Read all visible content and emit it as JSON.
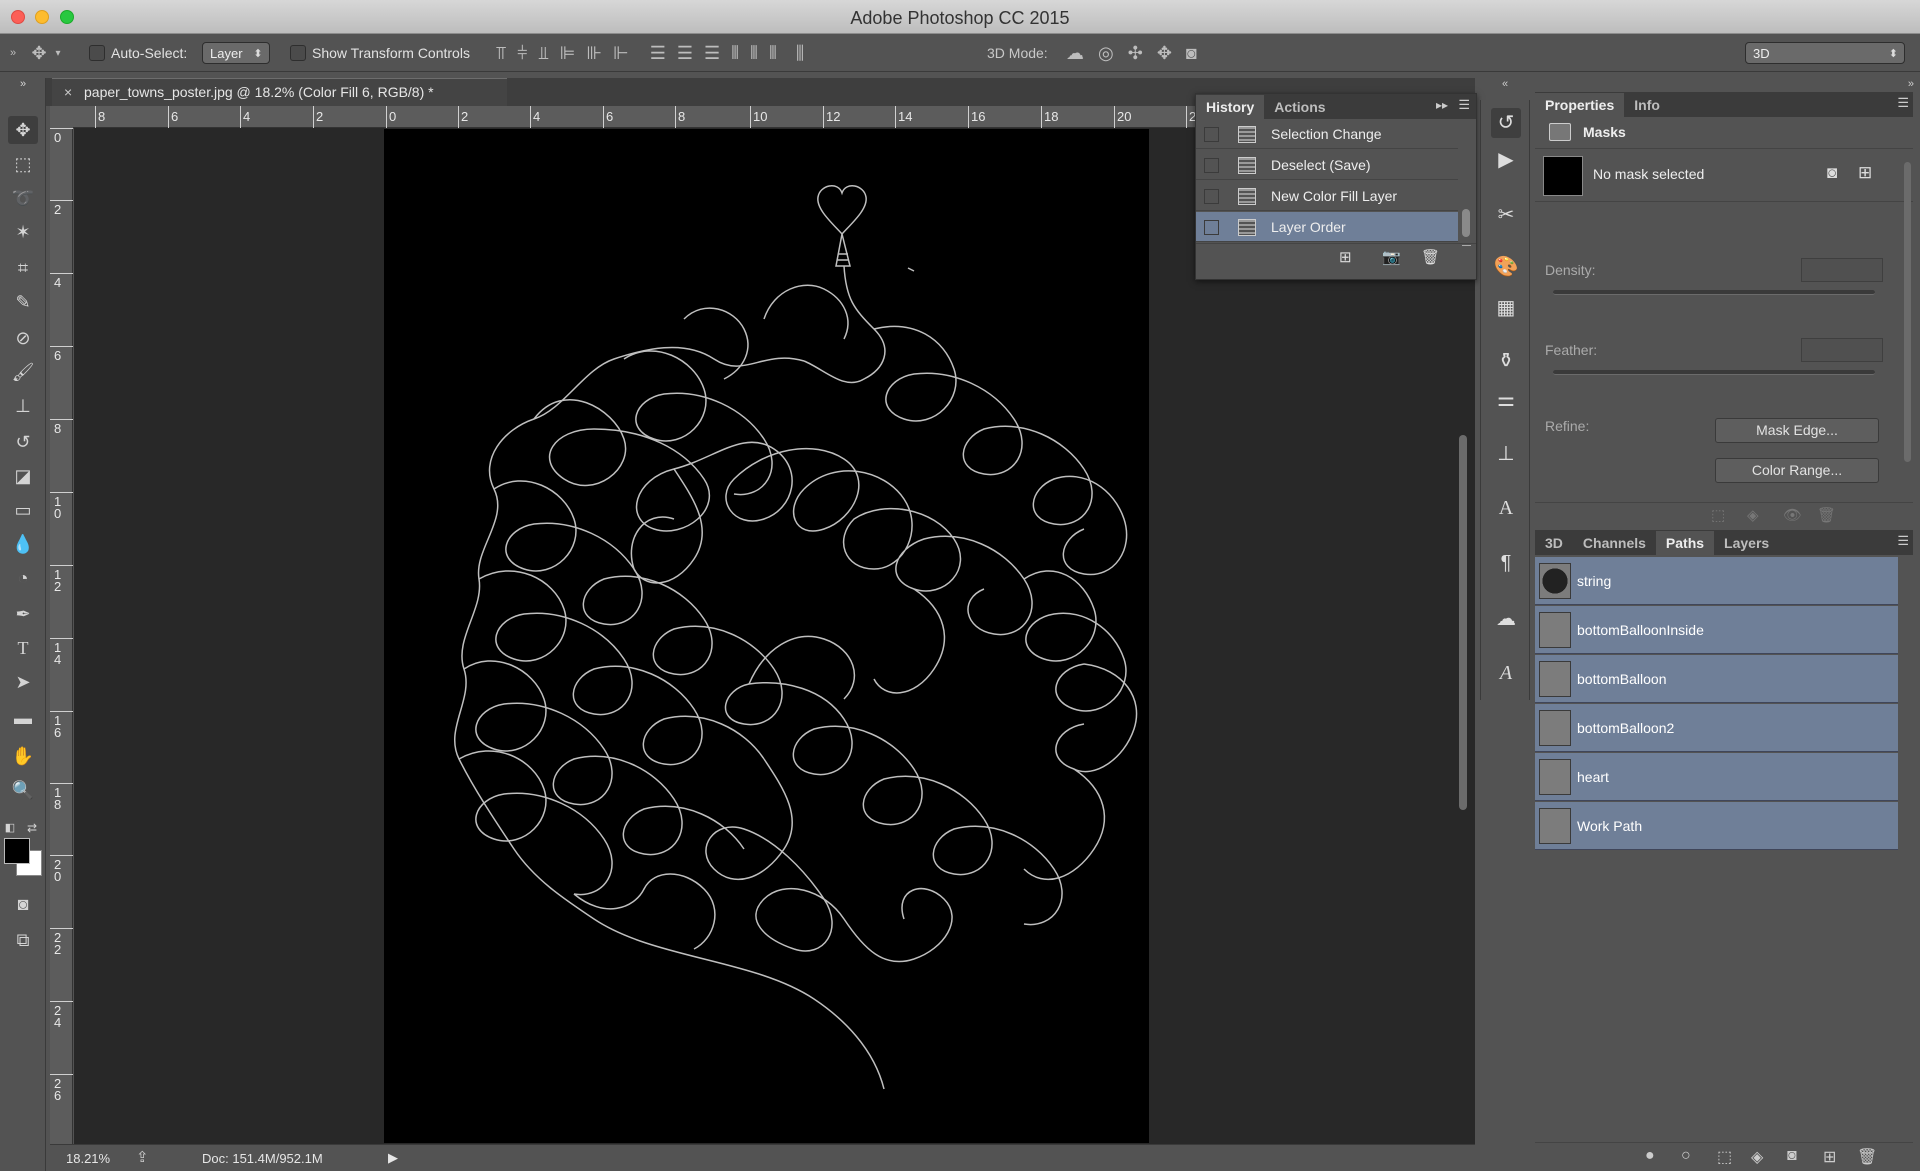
{
  "app": {
    "title": "Adobe Photoshop CC 2015"
  },
  "options": {
    "auto_select_label": "Auto-Select:",
    "auto_select_value": "Layer",
    "transform_label": "Show Transform Controls",
    "mode_label": "3D Mode:",
    "workspace_value": "3D"
  },
  "document": {
    "tab_title": "paper_towns_poster.jpg @ 18.2% (Color Fill 6, RGB/8) *"
  },
  "ruler": {
    "h_labels": [
      "8",
      "6",
      "4",
      "2",
      "0",
      "2",
      "4",
      "6",
      "8",
      "10",
      "12",
      "14",
      "16",
      "18",
      "20",
      "2"
    ],
    "v_labels": [
      "0",
      "2",
      "4",
      "6",
      "8",
      "1\n0",
      "1\n2",
      "1\n4",
      "1\n6",
      "1\n8",
      "2\n0",
      "2\n2",
      "2\n4",
      "2\n6"
    ]
  },
  "status": {
    "zoom": "18.21%",
    "doc": "Doc: 151.4M/952.1M"
  },
  "history": {
    "tabs": [
      "History",
      "Actions"
    ],
    "items": [
      "Selection Change",
      "Deselect (Save)",
      "New Color Fill Layer",
      "Layer Order"
    ],
    "selected_index": 3
  },
  "properties": {
    "tabs": [
      "Properties",
      "Info"
    ],
    "section": "Masks",
    "mask_status": "No mask selected",
    "density_label": "Density:",
    "feather_label": "Feather:",
    "refine_label": "Refine:",
    "mask_edge_button": "Mask Edge...",
    "color_range_button": "Color Range..."
  },
  "paths_panel": {
    "tabs": [
      "3D",
      "Channels",
      "Paths",
      "Layers"
    ],
    "active_tab": "Paths",
    "items": [
      "string",
      "bottomBalloonInside",
      "bottomBalloon",
      "bottomBalloon2",
      "heart",
      "Work Path"
    ]
  },
  "colors": {
    "selection": "#6f7f98",
    "panel": "#535353",
    "canvas_bg": "#282828"
  }
}
